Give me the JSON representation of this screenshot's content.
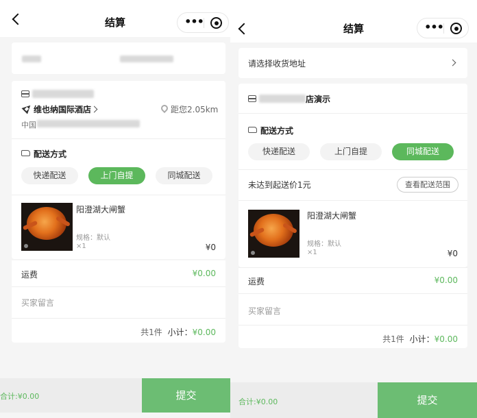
{
  "nav": {
    "title": "结算",
    "more_glyph": "•••"
  },
  "left": {
    "store": {
      "name_suffix": "",
      "hotel": "维也纳国际酒店",
      "distance": "距您2.05km",
      "addr_prefix": "中国"
    },
    "delivery": {
      "label": "配送方式",
      "options": [
        "快递配送",
        "上门自提",
        "同城配送"
      ],
      "selected": "上门自提"
    },
    "product": {
      "name": "阳澄湖大闸蟹",
      "spec": "规格：默认",
      "qty": "×1",
      "price": "¥0"
    },
    "shipping": {
      "label": "运费",
      "value": "¥0.00"
    },
    "remark_placeholder": "买家留言",
    "summary": {
      "count": "共1件",
      "subtotal_label": "小计：",
      "subtotal": "¥0.00"
    },
    "footer": {
      "total_label": "合计:",
      "total": "¥0.00",
      "submit": "提交"
    }
  },
  "right": {
    "address_prompt": "请选择收货地址",
    "store": {
      "name_suffix": "店演示"
    },
    "delivery": {
      "label": "配送方式",
      "options": [
        "快递配送",
        "上门自提",
        "同城配送"
      ],
      "selected": "同城配送"
    },
    "min_notice": "未达到起送价1元",
    "scope_button": "查看配送范围",
    "product": {
      "name": "阳澄湖大闸蟹",
      "spec": "规格：默认",
      "qty": "×1",
      "price": "¥0"
    },
    "shipping": {
      "label": "运费",
      "value": "¥0.00"
    },
    "remark_placeholder": "买家留言",
    "summary": {
      "count": "共1件",
      "subtotal_label": "小计：",
      "subtotal": "¥0.00"
    },
    "footer": {
      "total_label": "合计:",
      "total": "¥0.00",
      "submit": "提交"
    }
  },
  "colors": {
    "accent": "#5cb85c",
    "submit_bg": "#6cbd73",
    "page_bg": "#f5f5f5"
  }
}
